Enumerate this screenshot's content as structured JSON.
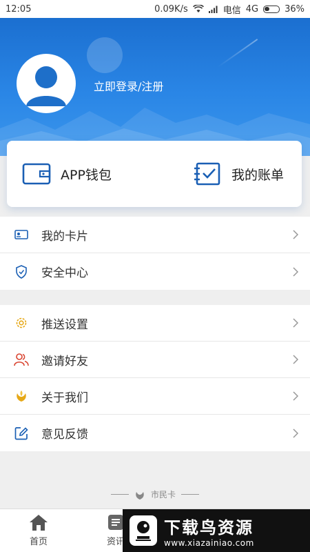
{
  "status_bar": {
    "time": "12:05",
    "speed": "0.09K/s",
    "carrier": "电信",
    "network": "4G",
    "battery": "36%",
    "icons": [
      "wifi-icon",
      "signal-icon",
      "battery-icon"
    ]
  },
  "header": {
    "login_text": "立即登录/注册",
    "gradient_top": "#1b6fd0",
    "gradient_bottom": "#3b96ec"
  },
  "card": {
    "wallet_label": "APP钱包",
    "bill_label": "我的账单",
    "accent": "#1a5fb4"
  },
  "menu_group_1": [
    {
      "label": "我的卡片",
      "icon": "card-icon"
    },
    {
      "label": "安全中心",
      "icon": "shield-icon"
    }
  ],
  "menu_group_2": [
    {
      "label": "推送设置",
      "icon": "gear-icon"
    },
    {
      "label": "邀请好友",
      "icon": "people-icon"
    },
    {
      "label": "关于我们",
      "icon": "logo-icon"
    },
    {
      "label": "意见反馈",
      "icon": "edit-icon"
    }
  ],
  "footer": {
    "brand": "市民卡"
  },
  "tabbar": [
    {
      "label": "首页",
      "icon": "home-icon"
    },
    {
      "label": "资讯",
      "icon": "news-icon"
    }
  ],
  "watermark": {
    "title": "下载鸟资源",
    "url": "www.xiazainiao.com"
  }
}
